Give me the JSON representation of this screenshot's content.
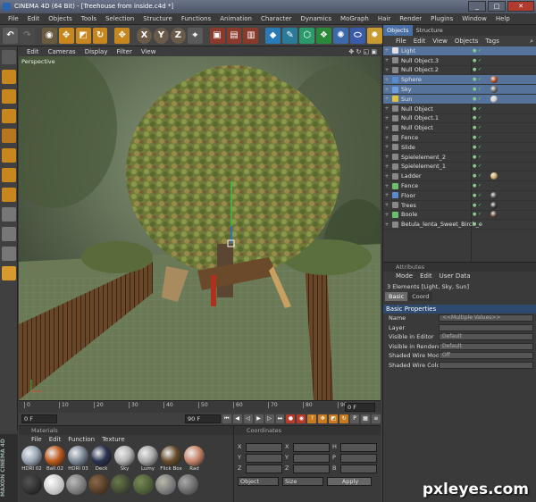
{
  "window": {
    "title": "CINEMA 4D (64 Bit) - [Treehouse from inside.c4d *]",
    "minimize": "_",
    "maximize": "□",
    "close": "✕"
  },
  "menubar": [
    "File",
    "Edit",
    "Objects",
    "Tools",
    "Selection",
    "Structure",
    "Functions",
    "Animation",
    "Character",
    "Dynamics",
    "MoGraph",
    "Hair",
    "Render",
    "Plugins",
    "Window",
    "Help"
  ],
  "viewport": {
    "menu": [
      "Edit",
      "Cameras",
      "Display",
      "Filter",
      "View"
    ],
    "label": "Perspective"
  },
  "timeline": {
    "ticks": [
      "0",
      "10",
      "20",
      "30",
      "40",
      "50",
      "60",
      "70",
      "80",
      "90"
    ],
    "end_label": "0 F"
  },
  "playbar": {
    "start_field": "0 F",
    "end_field": "90 F"
  },
  "materials": {
    "header": "Materials",
    "menu": [
      "File",
      "Edit",
      "Function",
      "Texture"
    ],
    "items": [
      {
        "label": "HDRI 02",
        "color": "#9aa7b5"
      },
      {
        "label": "Ball.02",
        "color": "#c05a1e"
      },
      {
        "label": "HDRI 03",
        "color": "#7d8a9a"
      },
      {
        "label": "Deck",
        "color": "#2a3350"
      },
      {
        "label": "Sky",
        "color": "#b5b5b5"
      },
      {
        "label": "Lumy",
        "color": "#a8a8a8"
      },
      {
        "label": "Flick Box",
        "color": "#6a4e2e"
      },
      {
        "label": "Rad",
        "color": "#c8866a"
      }
    ]
  },
  "coordinates": {
    "header": "Coordinates",
    "rows": [
      {
        "a": "X",
        "b": "X",
        "c": "H"
      },
      {
        "a": "Y",
        "b": "Y",
        "c": "P"
      },
      {
        "a": "Z",
        "b": "Z",
        "c": "B"
      }
    ],
    "object_select": "Object",
    "size_select": "Size",
    "apply": "Apply"
  },
  "objects": {
    "tabs": [
      "Objects",
      "Structure"
    ],
    "menu": [
      "File",
      "Edit",
      "View",
      "Objects",
      "Tags"
    ],
    "rows": [
      {
        "name": "Light",
        "icon": "#e0e0e0",
        "sel": true,
        "tag": ""
      },
      {
        "name": "Null Object.3",
        "icon": "#888",
        "sel": false,
        "tag": ""
      },
      {
        "name": "Null Object.2",
        "icon": "#888",
        "sel": false,
        "tag": ""
      },
      {
        "name": "Sphere",
        "icon": "#5a8ad0",
        "sel": true,
        "tag": "#b04a20"
      },
      {
        "name": "Sky",
        "icon": "#6aa0e0",
        "sel": true,
        "tag": "#666"
      },
      {
        "name": "Sun",
        "icon": "#e0c040",
        "sel": true,
        "tag": "#ccc"
      },
      {
        "name": "Null Object",
        "icon": "#888",
        "sel": false,
        "tag": ""
      },
      {
        "name": "Null Object.1",
        "icon": "#888",
        "sel": false,
        "tag": ""
      },
      {
        "name": "Null Object",
        "icon": "#888",
        "sel": false,
        "tag": ""
      },
      {
        "name": "Fence",
        "icon": "#888",
        "sel": false,
        "tag": ""
      },
      {
        "name": "Slide",
        "icon": "#888",
        "sel": false,
        "tag": ""
      },
      {
        "name": "Spielelement_2",
        "icon": "#888",
        "sel": false,
        "tag": ""
      },
      {
        "name": "Spielelement_1",
        "icon": "#888",
        "sel": false,
        "tag": ""
      },
      {
        "name": "Ladder",
        "icon": "#888",
        "sel": false,
        "tag": "#c8a860"
      },
      {
        "name": "Fence",
        "icon": "#6ac06a",
        "sel": false,
        "tag": ""
      },
      {
        "name": "Floor",
        "icon": "#5a8ad0",
        "sel": false,
        "tag": "#444"
      },
      {
        "name": "Trees",
        "icon": "#888",
        "sel": false,
        "tag": "#333"
      },
      {
        "name": "Boole",
        "icon": "#6ac06a",
        "sel": false,
        "tag": "#5a4030"
      },
      {
        "name": "Betula_lenta_Sweet_Birch_e",
        "icon": "#888",
        "sel": false,
        "tag": ""
      }
    ]
  },
  "attributes": {
    "header": "Attributes",
    "menu": [
      "Mode",
      "Edit",
      "User Data"
    ],
    "elements": "3 Elements [Light, Sky, Sun]",
    "tabs": [
      "Basic",
      "Coord"
    ],
    "section": "Basic Properties",
    "rows": [
      {
        "label": "Name",
        "value": "<<Multiple Values>>"
      },
      {
        "label": "Layer",
        "value": ""
      },
      {
        "label": "Visible in Editor",
        "value": "Default"
      },
      {
        "label": "Visible in Renderer",
        "value": "Default"
      },
      {
        "label": "Shaded Wire Mode",
        "value": "Off"
      },
      {
        "label": "Shaded Wire Color",
        "value": ""
      }
    ]
  },
  "watermark": "pxleyes.com"
}
